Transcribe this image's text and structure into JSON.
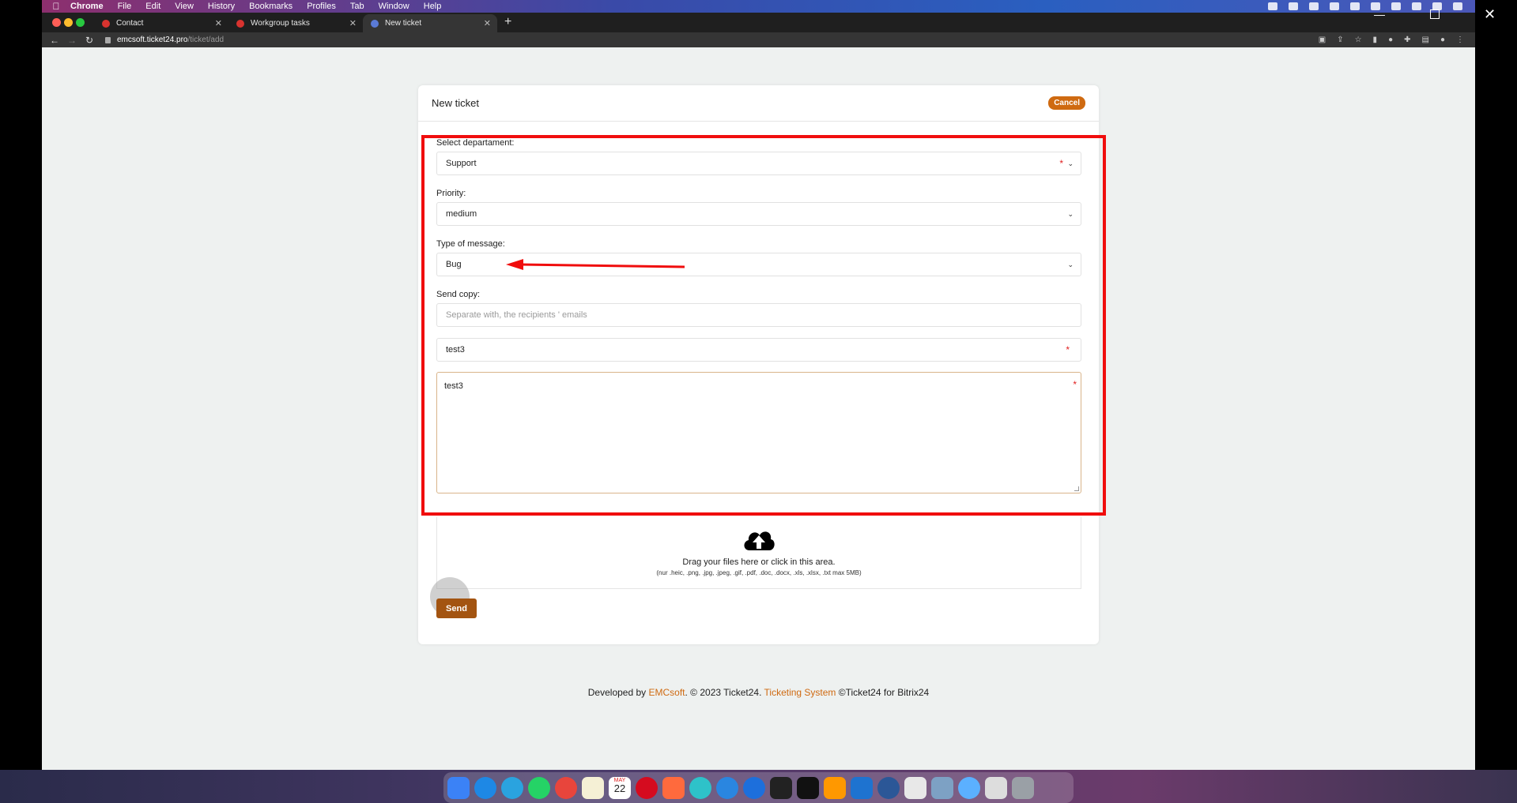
{
  "menubar": {
    "app": "Chrome",
    "items": [
      "File",
      "Edit",
      "View",
      "History",
      "Bookmarks",
      "Profiles",
      "Tab",
      "Window",
      "Help"
    ]
  },
  "tabs": [
    {
      "label": "Contact"
    },
    {
      "label": "Workgroup tasks"
    },
    {
      "label": "New ticket"
    }
  ],
  "address": {
    "host": "emcsoft.ticket24.pro",
    "path": "/ticket/add"
  },
  "form": {
    "title": "New ticket",
    "cancel_label": "Cancel",
    "department_label": "Select departament:",
    "department_value": "Support",
    "priority_label": "Priority:",
    "priority_value": "medium",
    "type_label": "Type of message:",
    "type_value": "Bug",
    "copy_label": "Send copy:",
    "copy_placeholder": "Separate with, the recipients ' emails",
    "subject_value": "test3",
    "message_value": "test3",
    "required_mark": "*",
    "drop_title": "Drag your files here or click in this area.",
    "drop_hint": "(nur .heic, .png, .jpg, .jpeg, .gif, .pdf, .doc, .docx, .xls, .xlsx, .txt max 5MB)",
    "send_label": "Send"
  },
  "footer": {
    "prefix": "Developed by ",
    "company": "EMCsoft",
    "middle": ". © 2023 Ticket24. ",
    "product": "Ticketing System",
    "suffix": " ©Ticket24 for Bitrix24"
  },
  "dock": {
    "calendar_month": "MAY",
    "calendar_day": "22"
  },
  "colors": {
    "accent": "#cf6a11",
    "send": "#a35411",
    "annotation": "#f00d0d"
  }
}
